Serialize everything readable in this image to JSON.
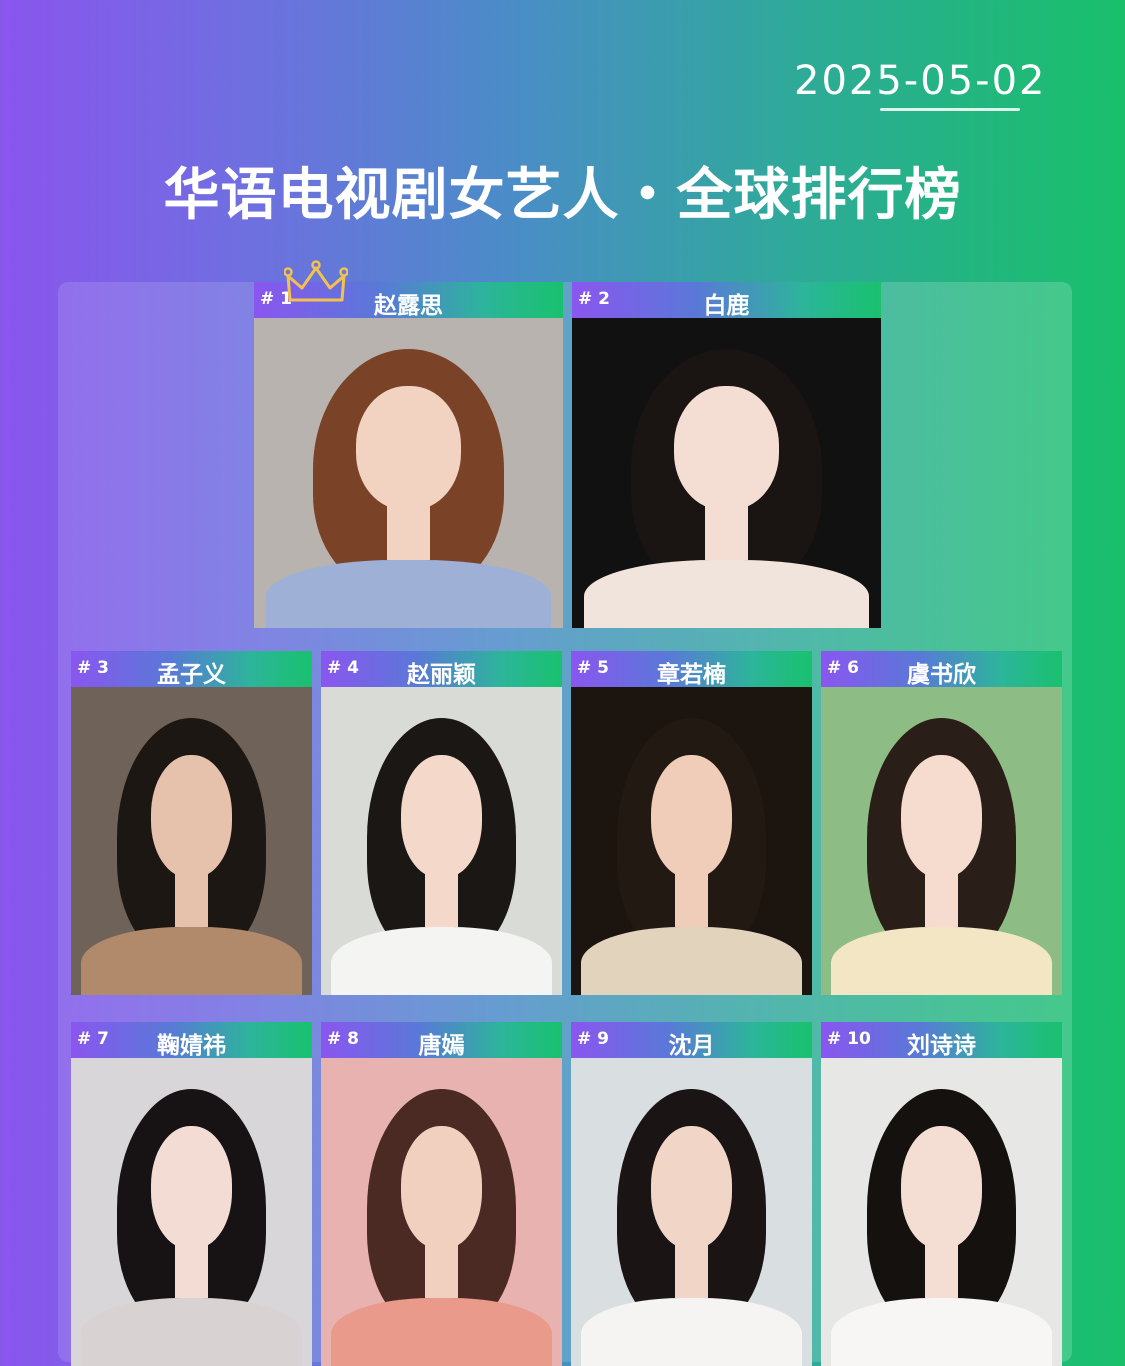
{
  "date": "2025-05-02",
  "title": "华语电视剧女艺人・全球排行榜",
  "crown_icon": "crown-icon",
  "cards": [
    {
      "rank": "# 1",
      "name": "赵露思",
      "bg": "#b8b3ae",
      "hair": "#7a4227",
      "skin": "#f2d2c0",
      "cloth": "#9fb0d6"
    },
    {
      "rank": "# 2",
      "name": "白鹿",
      "bg": "#111111",
      "hair": "#1a1412",
      "skin": "#f4ddd2",
      "cloth": "#f1e4dc"
    },
    {
      "rank": "# 3",
      "name": "孟子义",
      "bg": "#6f6258",
      "hair": "#1d1714",
      "skin": "#e6c2ad",
      "cloth": "#b08a6b"
    },
    {
      "rank": "# 4",
      "name": "赵丽颖",
      "bg": "#d9dcd6",
      "hair": "#1b1715",
      "skin": "#f4d9cb",
      "cloth": "#f4f4f2"
    },
    {
      "rank": "# 5",
      "name": "章若楠",
      "bg": "#1b140f",
      "hair": "#231913",
      "skin": "#efcdb8",
      "cloth": "#e2d3bd"
    },
    {
      "rank": "# 6",
      "name": "虞书欣",
      "bg": "#8dbd84",
      "hair": "#2a1e18",
      "skin": "#f5dccf",
      "cloth": "#f3e6c4"
    },
    {
      "rank": "# 7",
      "name": "鞠婧祎",
      "bg": "#d8d6d8",
      "hair": "#171315",
      "skin": "#f3dcd4",
      "cloth": "#d9d2d2"
    },
    {
      "rank": "# 8",
      "name": "唐嫣",
      "bg": "#e7b2b0",
      "hair": "#4a2a22",
      "skin": "#f2d0c0",
      "cloth": "#e99a8a"
    },
    {
      "rank": "# 9",
      "name": "沈月",
      "bg": "#d9dfe0",
      "hair": "#1a1414",
      "skin": "#f1d6c8",
      "cloth": "#f6f4f2"
    },
    {
      "rank": "# 10",
      "name": "刘诗诗",
      "bg": "#e7e8e6",
      "hair": "#15110f",
      "skin": "#f4ded3",
      "cloth": "#f7f6f4"
    }
  ]
}
